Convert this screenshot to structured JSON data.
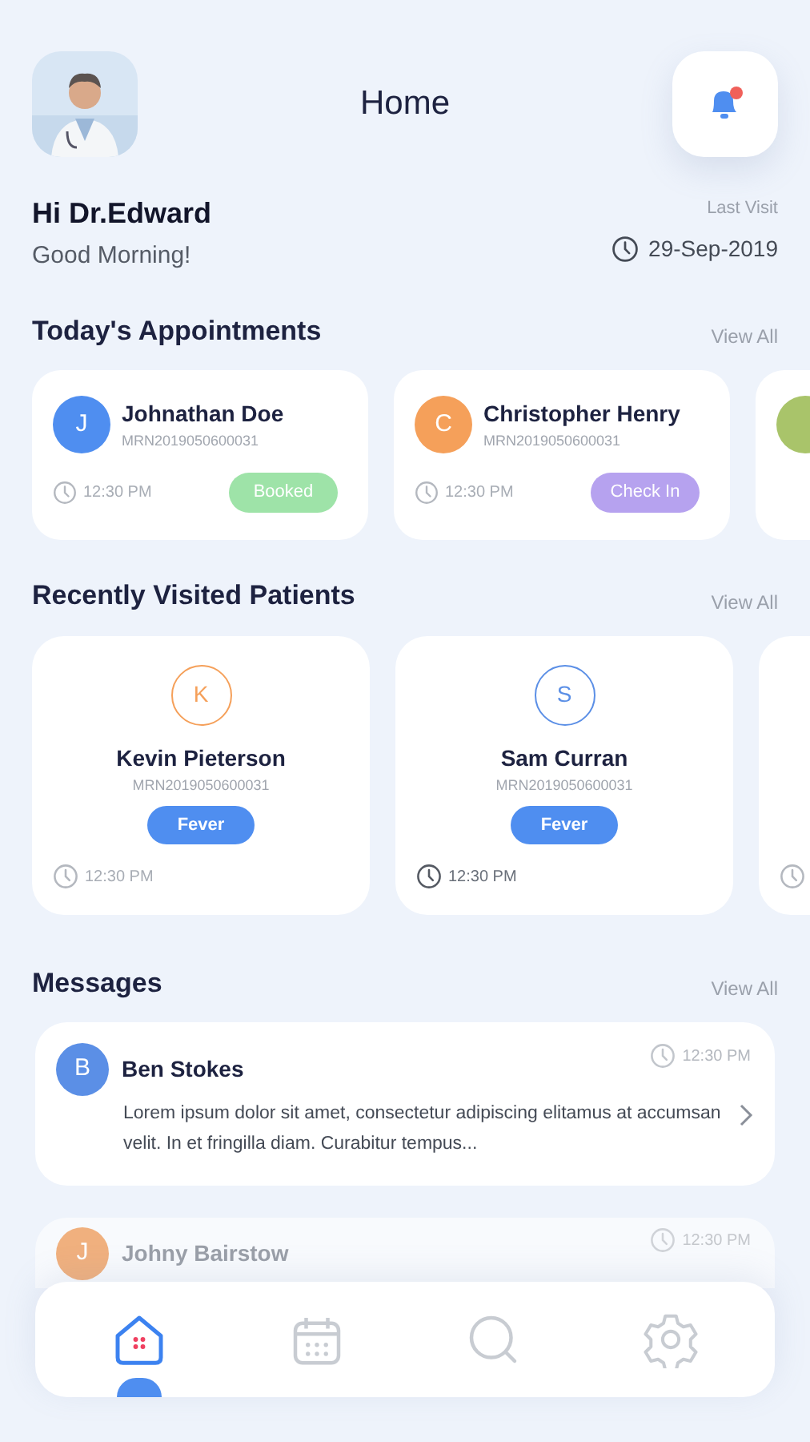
{
  "header": {
    "title": "Home",
    "notification_dot": true
  },
  "greeting": {
    "name": "Hi Dr.Edward",
    "message": "Good Morning!",
    "last_visit_label": "Last Visit",
    "last_visit_date": "29-Sep-2019"
  },
  "appointments": {
    "title": "Today's Appointments",
    "view_all": "View All",
    "items": [
      {
        "initial": "J",
        "name": "Johnathan Doe",
        "mrn": "MRN2019050600031",
        "time": "12:30 PM",
        "status": {
          "label": "Booked",
          "color": "#9ee3a8"
        },
        "color": "#4f8ef0"
      },
      {
        "initial": "C",
        "name": "Christopher Henry",
        "mrn": "MRN2019050600031",
        "time": "12:30 PM",
        "status": {
          "label": "Check In",
          "color": "#b6a2ef"
        },
        "color": "#f5a05a"
      },
      {
        "color": "#a9c46a"
      }
    ]
  },
  "recent_patients": {
    "title": "Recently Visited Patients",
    "view_all": "View All",
    "items": [
      {
        "initial": "K",
        "name": "Kevin Pieterson",
        "mrn": "MRN2019050600031",
        "tag": "Fever",
        "time": "12:30 PM",
        "color": "#f5a05a"
      },
      {
        "initial": "S",
        "name": "Sam Curran",
        "mrn": "MRN2019050600031",
        "tag": "Fever",
        "time": "12:30 PM",
        "color": "#5b8fe6"
      }
    ]
  },
  "messages": {
    "title": "Messages",
    "view_all": "View All",
    "items": [
      {
        "initial": "B",
        "name": "Ben Stokes",
        "time": "12:30 PM",
        "text": "Lorem ipsum dolor sit amet, consectetur adipiscing elitamus at accumsan velit. In et fringilla diam. Curabitur tempus...",
        "faded": false,
        "color": "#5b8fe6"
      },
      {
        "initial": "J",
        "name": "Johny Bairstow",
        "time": "12:30 PM",
        "faded": true,
        "color": "#f0b07e"
      }
    ]
  },
  "nav": [
    {
      "kind": "home",
      "selected": true
    },
    {
      "kind": "calendar",
      "selected": false
    },
    {
      "kind": "search",
      "selected": false
    },
    {
      "kind": "settings",
      "selected": false
    }
  ]
}
